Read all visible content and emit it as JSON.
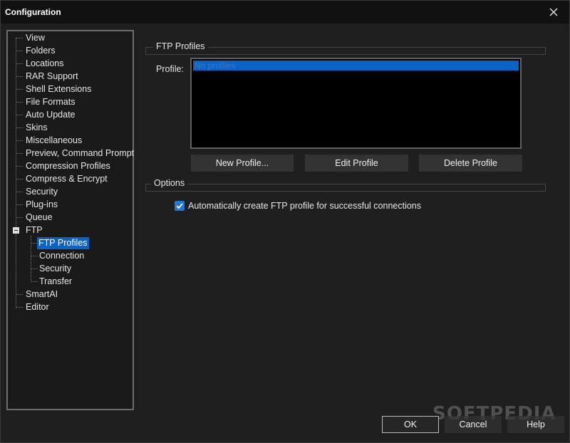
{
  "window": {
    "title": "Configuration"
  },
  "tree": {
    "items": [
      {
        "label": "View"
      },
      {
        "label": "Folders"
      },
      {
        "label": "Locations"
      },
      {
        "label": "RAR Support"
      },
      {
        "label": "Shell Extensions"
      },
      {
        "label": "File Formats"
      },
      {
        "label": "Auto Update"
      },
      {
        "label": "Skins"
      },
      {
        "label": "Miscellaneous"
      },
      {
        "label": "Preview, Command Prompt"
      },
      {
        "label": "Compression Profiles"
      },
      {
        "label": "Compress & Encrypt"
      },
      {
        "label": "Security"
      },
      {
        "label": "Plug-ins"
      },
      {
        "label": "Queue"
      },
      {
        "label": "FTP",
        "expanded": true
      },
      {
        "label": "FTP Profiles",
        "selected": true
      },
      {
        "label": "Connection"
      },
      {
        "label": "Security"
      },
      {
        "label": "Transfer"
      },
      {
        "label": "SmartAI"
      },
      {
        "label": "Editor"
      }
    ]
  },
  "ftp_profiles": {
    "group_label": "FTP Profiles",
    "profile_label": "Profile:",
    "list_items": [
      "No profiles"
    ],
    "new_button": "New Profile...",
    "edit_button": "Edit Profile",
    "delete_button": "Delete Profile"
  },
  "options": {
    "group_label": "Options",
    "auto_create_label": "Automatically create FTP profile for successful connections",
    "auto_create_checked": true
  },
  "footer": {
    "ok": "OK",
    "cancel": "Cancel",
    "help": "Help"
  },
  "watermark": "SOFTPEDIA",
  "colors": {
    "accent": "#0a64c8",
    "background": "#1f1f1f",
    "checkbox": "#1e78d4"
  }
}
